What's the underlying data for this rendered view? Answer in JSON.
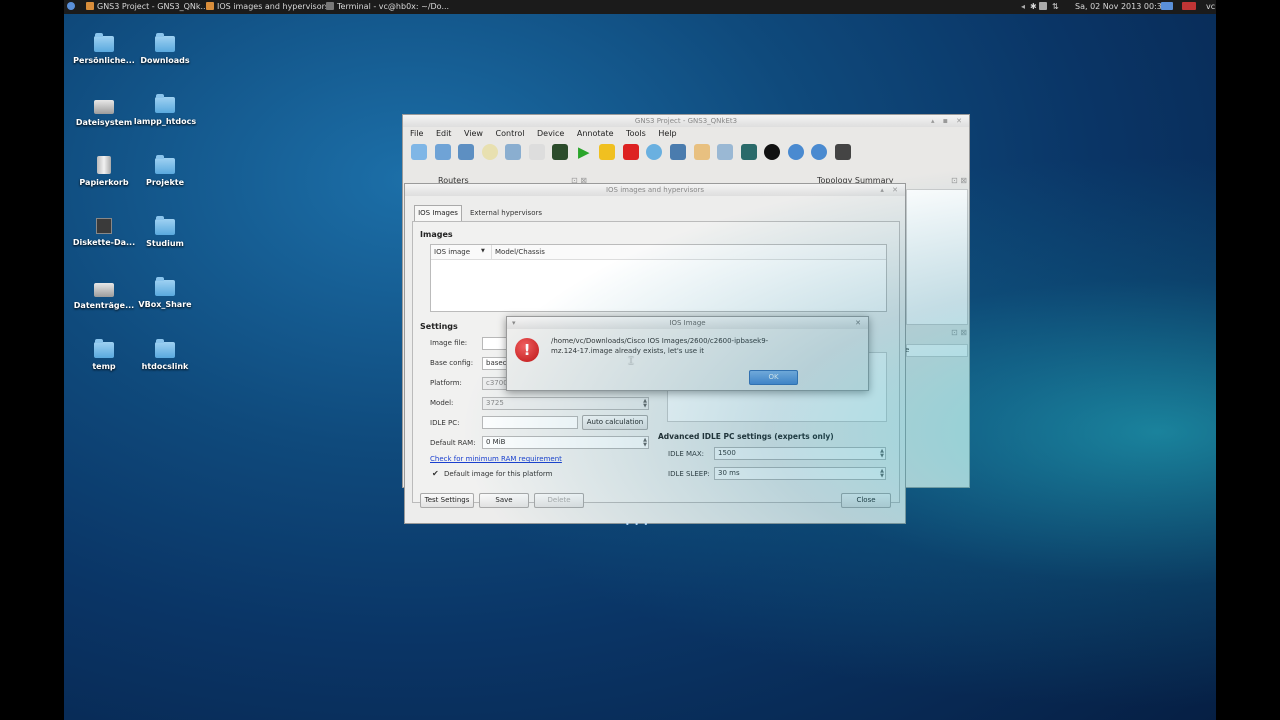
{
  "taskbar": {
    "tasks": [
      "GNS3 Project - GNS3_QNk...",
      "IOS images and hypervisors",
      "Terminal - vc@hb0x: ~/Do..."
    ],
    "clock": "Sa, 02 Nov 2013 00:32",
    "user": "vc"
  },
  "desktop": {
    "icons": [
      "Persönliche...",
      "Downloads",
      "Dateisystem",
      "lampp_htdocs",
      "Papierkorb",
      "Projekte",
      "Diskette-Da...",
      "Studium",
      "Datenträge...",
      "VBox_Share",
      "temp",
      "htdocslink"
    ]
  },
  "main_window": {
    "title": "GNS3 Project - GNS3_QNkEt3",
    "menu": [
      "File",
      "Edit",
      "View",
      "Control",
      "Device",
      "Annotate",
      "Tools",
      "Help"
    ],
    "panels": {
      "routers": "Routers",
      "topology": "Topology Summary",
      "partial": "e"
    }
  },
  "ios_dialog": {
    "title": "IOS images and hypervisors",
    "tabs": [
      "IOS Images",
      "External hypervisors"
    ],
    "images_header": "Images",
    "columns": [
      "IOS image",
      "Model/Chassis"
    ],
    "settings_header": "Settings",
    "labels": {
      "image_file": "Image file:",
      "base_config": "Base config:",
      "platform": "Platform:",
      "model": "Model:",
      "idle_pc": "IDLE PC:",
      "default_ram": "Default RAM:"
    },
    "values": {
      "base_config": "basec",
      "platform": "c3700",
      "model": "3725",
      "default_ram": "0 MiB"
    },
    "auto_calc": "Auto calculation",
    "ram_link": "Check for minimum RAM requirement",
    "default_checkbox": "Default image for this platform",
    "advanced_header": "Advanced IDLE PC settings (experts only)",
    "idle_max_label": "IDLE MAX:",
    "idle_max": "1500",
    "idle_sleep_label": "IDLE SLEEP:",
    "idle_sleep": "30 ms",
    "buttons": {
      "test": "Test Settings",
      "save": "Save",
      "delete": "Delete",
      "close": "Close"
    }
  },
  "alert": {
    "title": "IOS Image",
    "message": "/home/vc/Downloads/Cisco IOS Images/2600/c2600-ipbasek9-mz.124-17.image already exists, let's use it",
    "ok": "OK"
  }
}
